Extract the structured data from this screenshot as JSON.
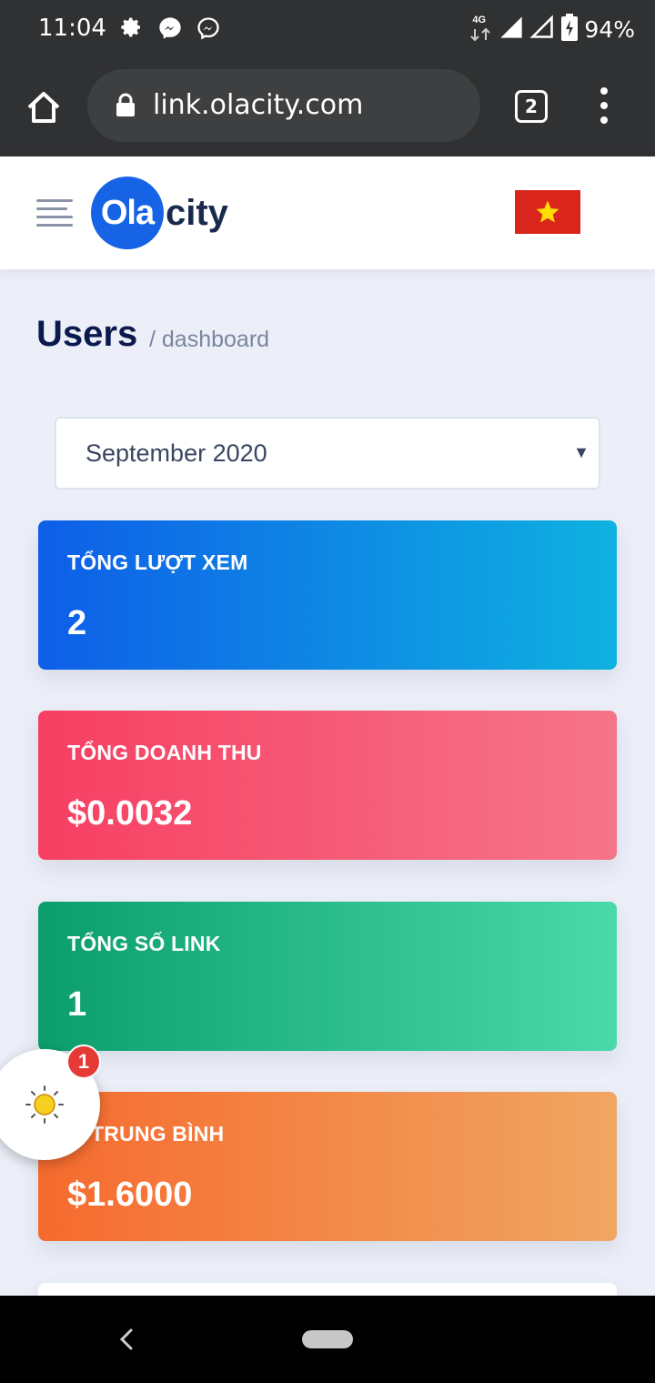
{
  "status_bar": {
    "time": "11:04",
    "network": "4G",
    "battery": "94%",
    "left_icons": [
      "settings-icon",
      "messenger-icon",
      "messenger-outline-icon"
    ],
    "right_icons": [
      "data-arrows-icon",
      "signal-icon",
      "signal-outline-icon",
      "battery-charging-icon"
    ]
  },
  "browser": {
    "url": "link.olacity.com",
    "tab_count": "2"
  },
  "header": {
    "logo_circle_text": "Ola",
    "logo_text": "city",
    "flag": "vietnam-flag",
    "brand_color": "#1663e5"
  },
  "breadcrumb": {
    "title": "Users",
    "path": "/ dashboard"
  },
  "month_select": {
    "value": "September 2020"
  },
  "cards": [
    {
      "label": "TỔNG LƯỢT XEM",
      "value": "2",
      "color_from": "#0e5ee8",
      "color_to": "#0eb2e0"
    },
    {
      "label": "TỔNG DOANH THU",
      "value": "$0.0032",
      "color_from": "#f73f63",
      "color_to": "#f67588"
    },
    {
      "label": "TỔNG SỐ LINK",
      "value": "1",
      "color_from": "#0b9e6c",
      "color_to": "#4ad9a9"
    },
    {
      "label": "M TRUNG BÌNH",
      "value": "$1.6000",
      "color_from": "#f66a2e",
      "color_to": "#f0a662"
    }
  ],
  "floating_bubble": {
    "badge_count": "1",
    "icon": "sun-icon"
  }
}
